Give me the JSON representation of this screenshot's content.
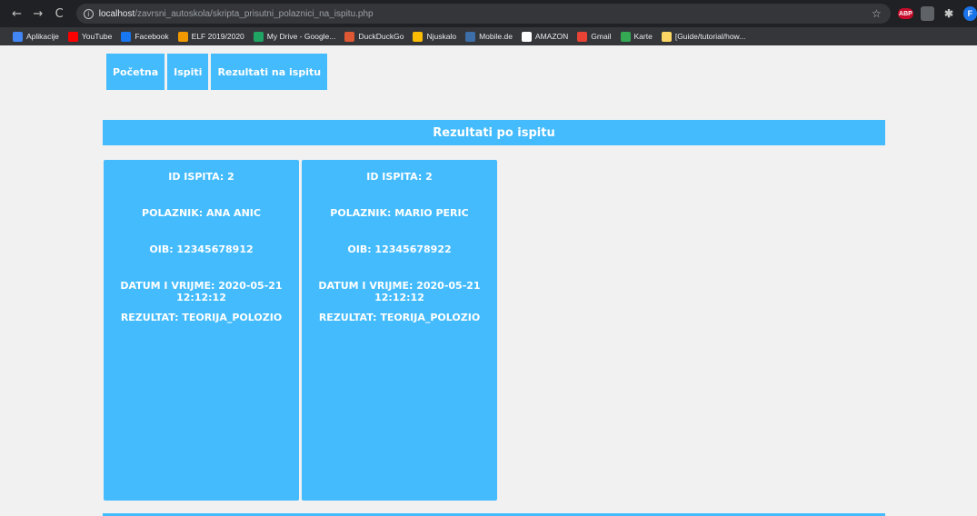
{
  "browser": {
    "url_host": "localhost",
    "url_path": "/zavrsni_autoskola/skripta_prisutni_polaznici_na_ispitu.php",
    "nav": {
      "back": "←",
      "forward": "→",
      "reload": "C"
    },
    "extensions": {
      "abp": "ABP",
      "profile": "F"
    }
  },
  "bookmarks": [
    {
      "label": "Aplikacije",
      "icon": "apps-icon",
      "color": "#4285f4"
    },
    {
      "label": "YouTube",
      "icon": "youtube-icon",
      "color": "#ff0000"
    },
    {
      "label": "Facebook",
      "icon": "facebook-icon",
      "color": "#1877f2"
    },
    {
      "label": "ELF 2019/2020",
      "icon": "elf-icon",
      "color": "#f29900"
    },
    {
      "label": "My Drive - Google...",
      "icon": "drive-icon",
      "color": "#1fa463"
    },
    {
      "label": "DuckDuckGo",
      "icon": "duckduckgo-icon",
      "color": "#de5833"
    },
    {
      "label": "Njuskalo",
      "icon": "njuskalo-icon",
      "color": "#fbbc04"
    },
    {
      "label": "Mobile.de",
      "icon": "mobilede-icon",
      "color": "#3d6ea8"
    },
    {
      "label": "AMAZON",
      "icon": "amazon-icon",
      "color": "#ffffff"
    },
    {
      "label": "Gmail",
      "icon": "gmail-icon",
      "color": "#ea4335"
    },
    {
      "label": "Karte",
      "icon": "maps-icon",
      "color": "#34a853"
    },
    {
      "label": "[Guide/tutorial/how...",
      "icon": "page-icon",
      "color": "#fdd663"
    }
  ],
  "nav": {
    "home": "Početna",
    "exams": "Ispiti",
    "results": "Rezultati na ispitu"
  },
  "section": {
    "title": "Rezultati po ispitu"
  },
  "results": [
    {
      "exam_id": "ID ISPITA: 2",
      "student": "POLAZNIK: ANA ANIC",
      "oib": "OIB: 12345678912",
      "datetime": "DATUM I VRIJME: 2020-05-21 12:12:12",
      "result": "REZULTAT: TEORIJA_POLOZIO"
    },
    {
      "exam_id": "ID ISPITA: 2",
      "student": "POLAZNIK: MARIO PERIC",
      "oib": "OIB: 12345678922",
      "datetime": "DATUM I VRIJME: 2020-05-21 12:12:12",
      "result": "REZULTAT: TEORIJA_POLOZIO"
    }
  ],
  "colors": {
    "accent": "#44bbfd",
    "page_bg": "#f1f1f1"
  }
}
